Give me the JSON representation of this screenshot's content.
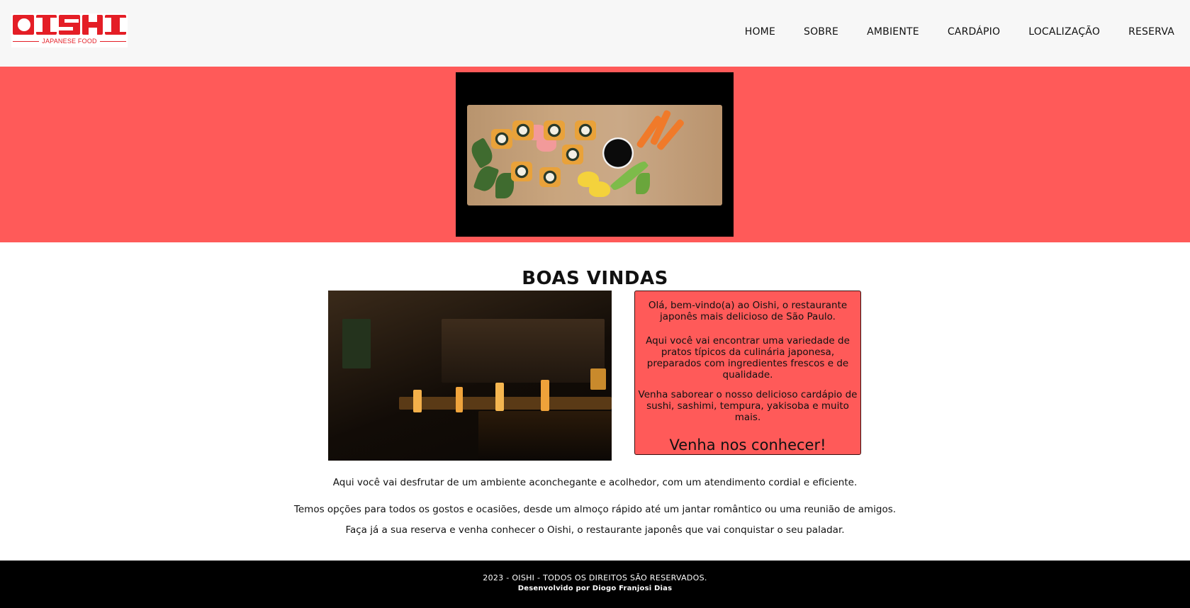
{
  "brand": {
    "logo_alt": "OISHI",
    "tagline": "JAPANESE FOOD",
    "color": "#e41e26"
  },
  "nav": {
    "items": [
      {
        "label": "HOME"
      },
      {
        "label": "SOBRE"
      },
      {
        "label": "AMBIENTE"
      },
      {
        "label": "CARDÁPIO"
      },
      {
        "label": "LOCALIZAÇÃO"
      },
      {
        "label": "RESERVA"
      }
    ]
  },
  "colors": {
    "accent": "#ff5a59",
    "header_bg": "#f7f7f7",
    "footer_bg": "#000000"
  },
  "main": {
    "title": "BOAS VINDAS",
    "card": {
      "p1": "Olá, bem-vindo(a) ao Oishi, o restaurante japonês mais delicioso de São Paulo.",
      "p2": "Aqui você vai encontrar uma variedade de pratos típicos da culinária japonesa, preparados com ingredientes frescos e de qualidade.",
      "p3": "Venha saborear o nosso delicioso cardápio de sushi, sashimi, tempura, yakisoba e muito mais.",
      "cta": "Venha nos conhecer!"
    },
    "paragraphs": [
      "Aqui você vai desfrutar de um ambiente aconchegante e acolhedor, com um atendimento cordial e eficiente.",
      "Temos opções para todos os gostos e ocasiões, desde um almoço rápido até um jantar romântico ou uma reunião de amigos.",
      "Faça já a sua reserva e venha conhecer o Oishi, o restaurante japonês que vai conquistar o seu paladar."
    ]
  },
  "footer": {
    "copyright": "2023 - OISHI - TODOS OS DIREITOS SÃO RESERVADOS.",
    "credit": "Desenvolvido por Diogo Franjosi Dias"
  }
}
